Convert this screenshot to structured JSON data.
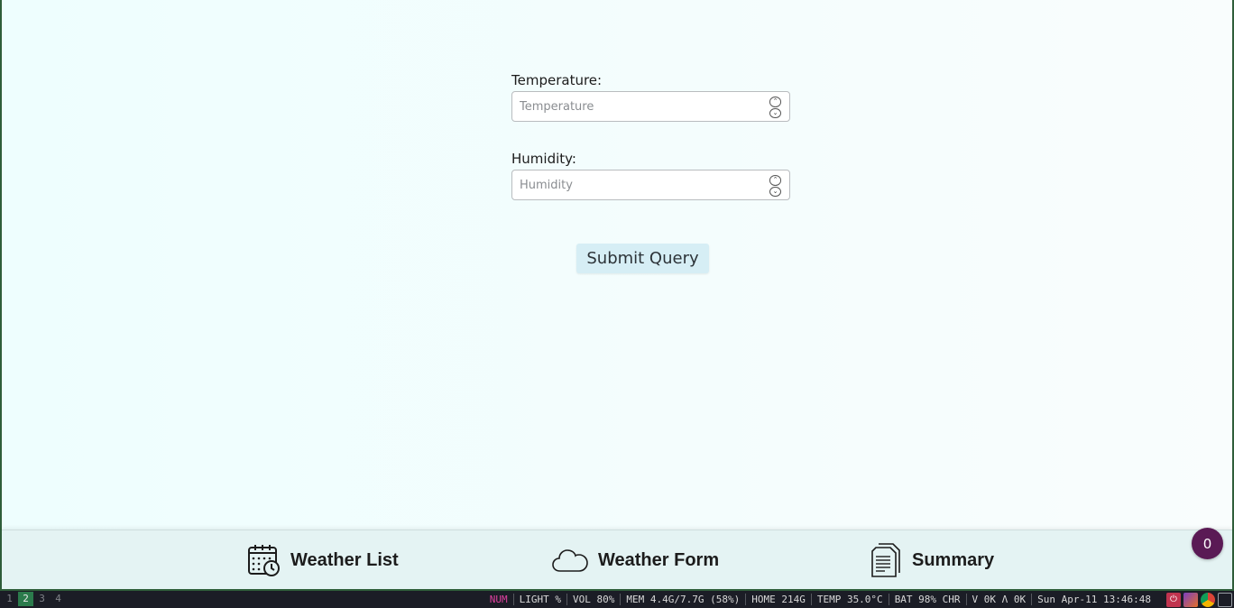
{
  "form": {
    "temperature_label": "Temperature:",
    "temperature_placeholder": "Temperature",
    "humidity_label": "Humidity:",
    "humidity_placeholder": "Humidity",
    "submit_label": "Submit Query"
  },
  "bottom_nav": {
    "items": [
      {
        "label": "Weather List",
        "icon": "calendar-clock-icon"
      },
      {
        "label": "Weather Form",
        "icon": "cloud-icon"
      },
      {
        "label": "Summary",
        "icon": "document-icon"
      }
    ],
    "badge_count": "0"
  },
  "statusbar": {
    "workspaces": [
      "1",
      "2",
      "3",
      "4"
    ],
    "active_workspace": "2",
    "num": "NUM",
    "light": "LIGHT %",
    "vol": "VOL 80%",
    "mem": "MEM 4.4G/7.7G (58%)",
    "home": "HOME 214G",
    "temp": "TEMP 35.0°C",
    "bat": "BAT 98% CHR",
    "net": "V 0K Λ 0K",
    "datetime": "Sun Apr-11 13:46:48"
  },
  "colors": {
    "accent": "#d6eef5",
    "badge": "#5a1a55",
    "active_workspace": "#2b7b4c",
    "num_indicator": "#e040a0"
  }
}
